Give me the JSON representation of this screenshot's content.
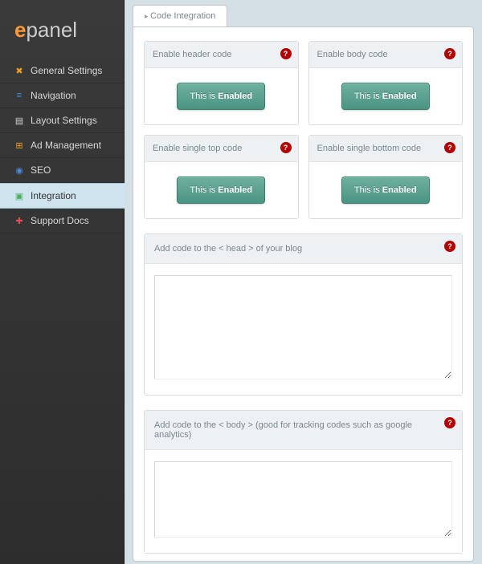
{
  "logo": {
    "prefix": "e",
    "rest": "panel"
  },
  "sidebar": {
    "items": [
      {
        "label": "General Settings",
        "icon": "✖",
        "color": "#f0a020"
      },
      {
        "label": "Navigation",
        "icon": "≡",
        "color": "#4a88d8"
      },
      {
        "label": "Layout Settings",
        "icon": "▤",
        "color": "#d0d0d0"
      },
      {
        "label": "Ad Management",
        "icon": "⊞",
        "color": "#f0a020"
      },
      {
        "label": "SEO",
        "icon": "◉",
        "color": "#4a88d8"
      },
      {
        "label": "Integration",
        "icon": "▣",
        "color": "#50b060"
      },
      {
        "label": "Support Docs",
        "icon": "✚",
        "color": "#e05050"
      }
    ]
  },
  "tab": {
    "label": "Code Integration"
  },
  "cards": [
    {
      "title": "Enable header code",
      "prefix": "This is ",
      "state": "Enabled"
    },
    {
      "title": "Enable body code",
      "prefix": "This is ",
      "state": "Enabled"
    },
    {
      "title": "Enable single top code",
      "prefix": "This is ",
      "state": "Enabled"
    },
    {
      "title": "Enable single bottom code",
      "prefix": "This is ",
      "state": "Enabled"
    }
  ],
  "sections": [
    {
      "title": "Add code to the < head > of your blog",
      "value": ""
    },
    {
      "title": "Add code to the < body > (good for tracking codes such as google analytics)",
      "value": ""
    }
  ],
  "help": "?"
}
